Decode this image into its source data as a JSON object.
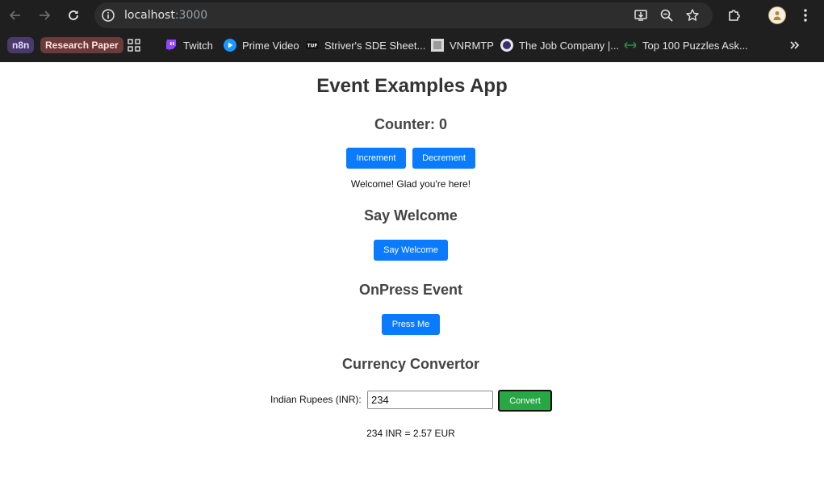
{
  "browser": {
    "url_host": "localhost",
    "url_port": ":3000",
    "bookmarks": [
      {
        "label": "n8n"
      },
      {
        "label": "Research Paper"
      },
      {
        "label": "Twitch"
      },
      {
        "label": "Prime Video"
      },
      {
        "label": "Striver's SDE Sheet..."
      },
      {
        "label": "VNRMTP"
      },
      {
        "label": "The Job Company |..."
      },
      {
        "label": "Top 100 Puzzles Ask..."
      }
    ]
  },
  "app": {
    "title": "Event Examples App",
    "counter": {
      "heading": "Counter: 0",
      "increment_label": "Increment",
      "decrement_label": "Decrement"
    },
    "welcome_message": "Welcome! Glad you're here!",
    "say_welcome": {
      "heading": "Say Welcome",
      "button_label": "Say Welcome"
    },
    "onpress": {
      "heading": "OnPress Event",
      "button_label": "Press Me"
    },
    "currency": {
      "heading": "Currency Convertor",
      "input_label": "Indian Rupees (INR):",
      "input_value": "234",
      "convert_label": "Convert",
      "result": "234 INR = 2.57 EUR"
    }
  },
  "colors": {
    "primary_button": "#0a7bff",
    "convert_button": "#28a745",
    "chrome_bg": "#1f1f1f"
  }
}
